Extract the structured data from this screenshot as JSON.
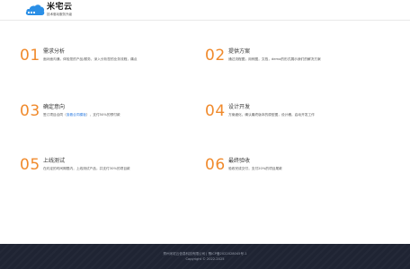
{
  "header": {
    "brand_name": "米宅云",
    "brand_slogan": "技术驱动服务升级"
  },
  "steps": [
    {
      "num": "01",
      "title": "需求分析",
      "desc": "面对面沟通，体验您的产品/服务，深入分析您的业务流程，痛点"
    },
    {
      "num": "02",
      "title": "提供方案",
      "desc": "通过流程图，用例图，文档，demo的形式展示我们的解决方案"
    },
    {
      "num": "03",
      "title": "确定意向",
      "desc_before": "签订项目合同（",
      "desc_link": "查看合同模板",
      "desc_after": "），支付50%的预付款"
    },
    {
      "num": "04",
      "title": "设计开发",
      "desc": "方案细化，确认最终版本的原型图，设计稿，启动开发工作"
    },
    {
      "num": "05",
      "title": "上线测试",
      "desc": "在约定的时间期限内，上线测试产品，并支付30%的项目款"
    },
    {
      "num": "06",
      "title": "最终验收",
      "desc": "验收完成交付，支付20%的项目尾款"
    }
  ],
  "footer": {
    "line1": "郑州米宅云信息科技有限公司 | 豫ICP备2022028045号-1",
    "line2": "Copyright © 2022-2025"
  }
}
